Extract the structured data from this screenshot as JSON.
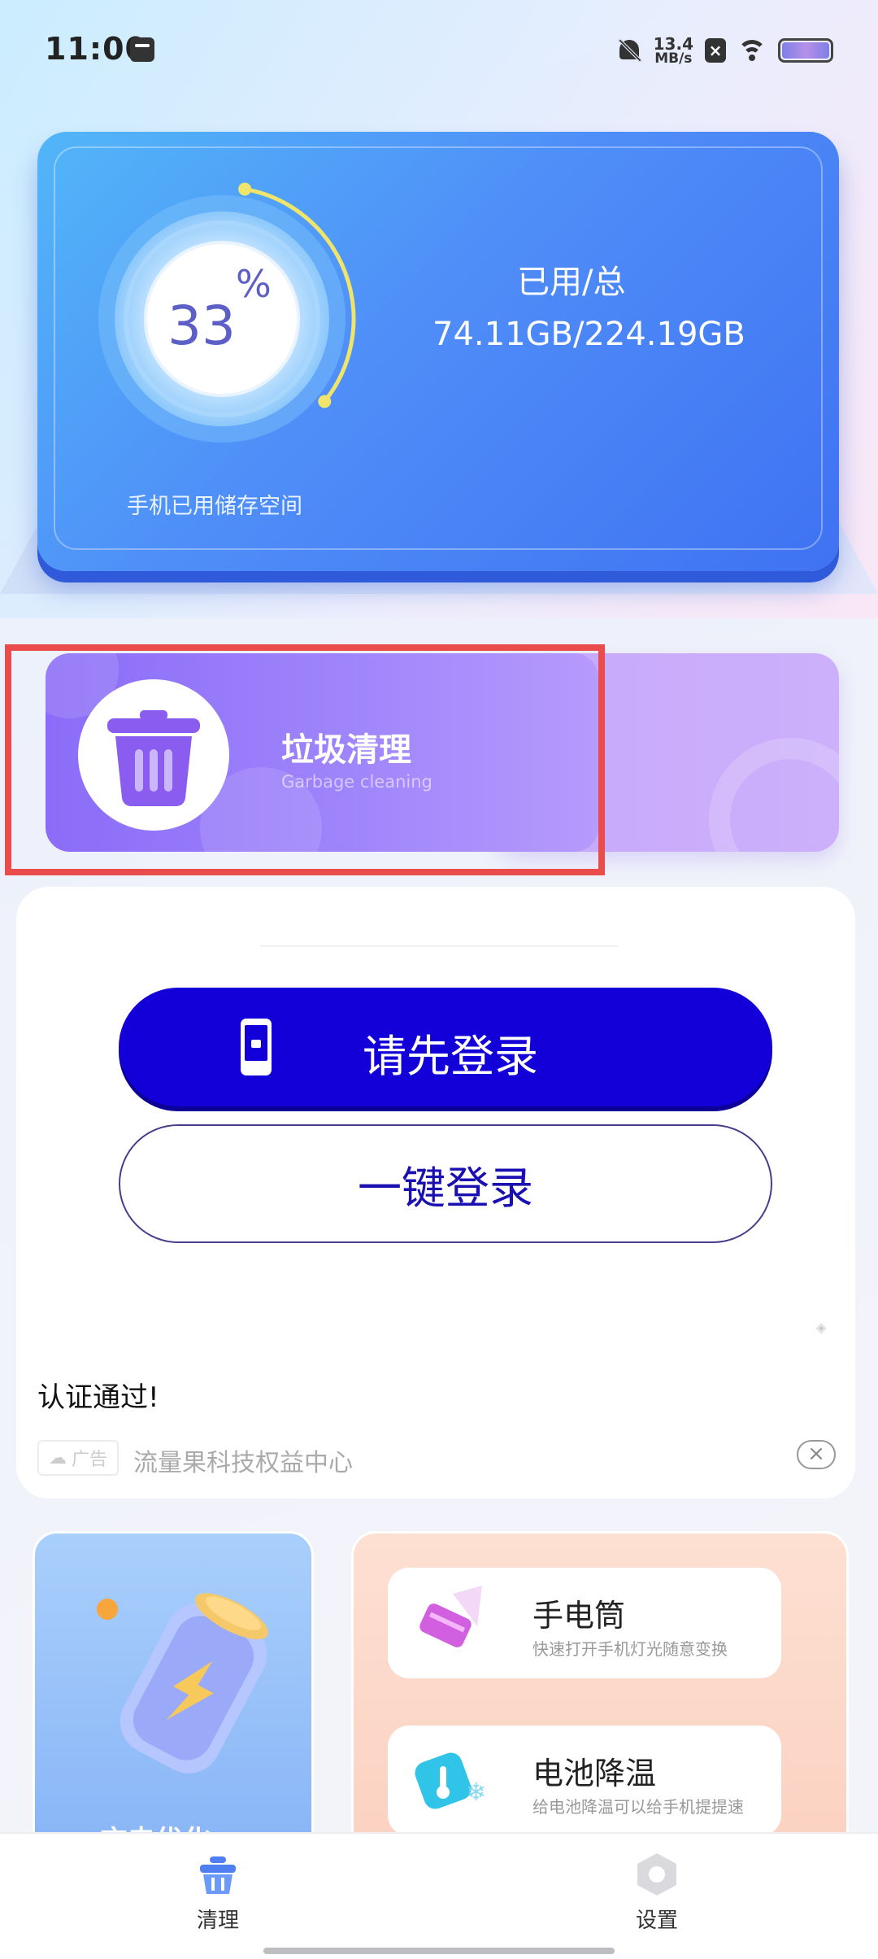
{
  "status_bar": {
    "time": "11:00",
    "speed_value": "13.4",
    "speed_unit": "MB/s",
    "x_badge": "×"
  },
  "storage": {
    "percent": "33",
    "percent_sign": "%",
    "used_label": "已用/总",
    "used_value": "74.11GB/224.19GB",
    "caption": "手机已用储存空间",
    "used_fraction": 0.33
  },
  "garbage": {
    "title": "垃圾清理",
    "subtitle": "Garbage cleaning"
  },
  "login_ad": {
    "primary_label": "请先登录",
    "secondary_label": "一键登录",
    "verify_text": "认证通过!",
    "ad_badge": "广告",
    "ad_source": "流量果科技权益中心",
    "close_symbol": "×"
  },
  "tiles": {
    "left_partial_text": "充电优化",
    "features": [
      {
        "title": "手电筒",
        "subtitle": "快速打开手机灯光随意变换",
        "icon": "flashlight-icon"
      },
      {
        "title": "电池降温",
        "subtitle": "给电池降温可以给手机提提速",
        "icon": "battery-cool-icon"
      }
    ]
  },
  "nav": {
    "items": [
      {
        "label": "清理",
        "icon": "basket-icon"
      },
      {
        "label": "设置",
        "icon": "hexagon-settings-icon"
      }
    ]
  },
  "colors": {
    "primary_button": "#1300d9",
    "card_blue": "#4f8ef8",
    "card_purple": "#8b6cf8",
    "highlight": "#ea4c4c"
  }
}
